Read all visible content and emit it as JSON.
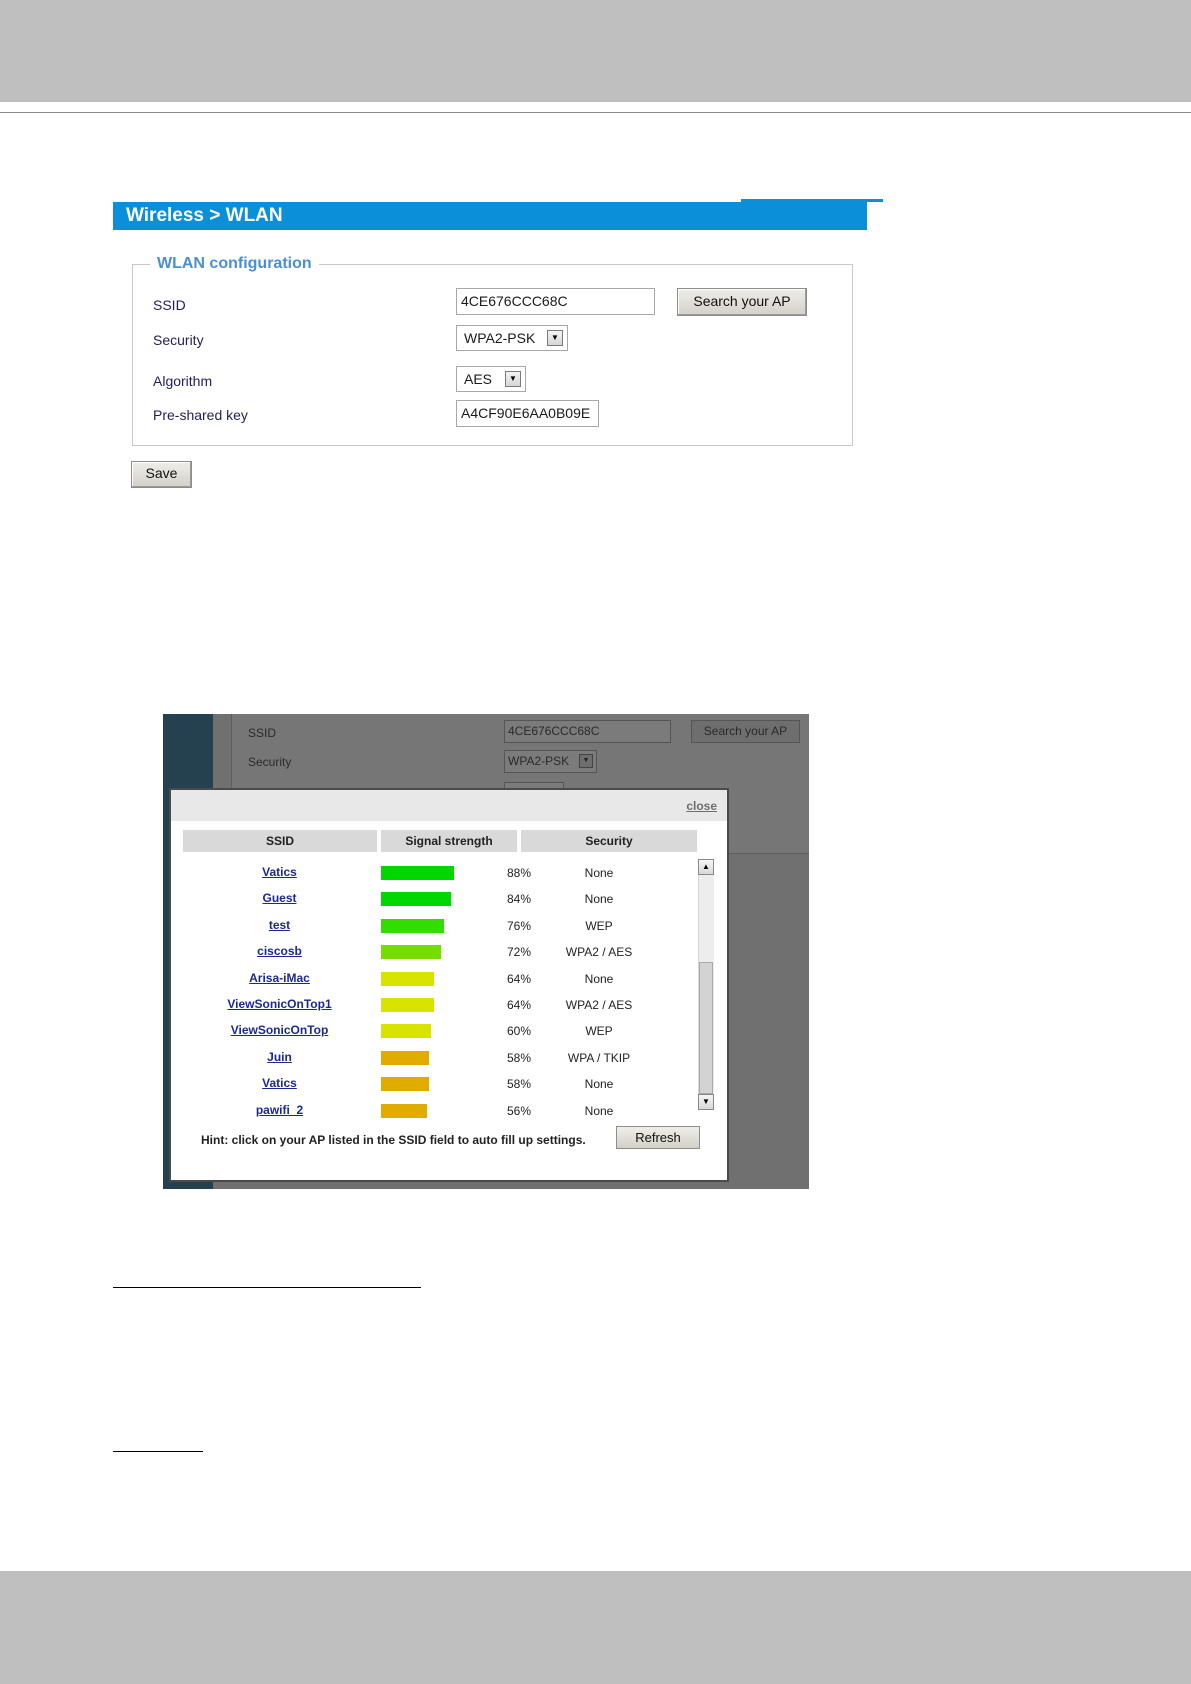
{
  "wlan_panel": {
    "breadcrumb": "Wireless  > WLAN",
    "legend": "WLAN configuration",
    "ssid_label": "SSID",
    "ssid_value": "4CE676CCC68C",
    "search_button": "Search your AP",
    "security_label": "Security",
    "security_value": "WPA2-PSK",
    "algorithm_label": "Algorithm",
    "algorithm_value": "AES",
    "psk_label": "Pre-shared key",
    "psk_value": "A4CF90E6AA0B09E",
    "save_button": "Save"
  },
  "background_form": {
    "ssid_label": "SSID",
    "ssid_value": "4CE676CCC68C",
    "search_button": "Search your AP",
    "security_label": "Security",
    "security_value": "WPA2-PSK"
  },
  "ap_dialog": {
    "close_link": "close",
    "headers": [
      "SSID",
      "Signal strength",
      "Security"
    ],
    "rows": [
      {
        "ssid": "Vatics",
        "signal": 88,
        "signal_label": "88%",
        "security": "None",
        "bar_color": "#00d600"
      },
      {
        "ssid": "Guest",
        "signal": 84,
        "signal_label": "84%",
        "security": "None",
        "bar_color": "#00d600"
      },
      {
        "ssid": "test",
        "signal": 76,
        "signal_label": "76%",
        "security": "WEP",
        "bar_color": "#33dd00"
      },
      {
        "ssid": "ciscosb",
        "signal": 72,
        "signal_label": "72%",
        "security": "WPA2 / AES",
        "bar_color": "#77dd00"
      },
      {
        "ssid": "Arisa-iMac",
        "signal": 64,
        "signal_label": "64%",
        "security": "None",
        "bar_color": "#d9e300"
      },
      {
        "ssid": "ViewSonicOnTop1",
        "signal": 64,
        "signal_label": "64%",
        "security": "WPA2 / AES",
        "bar_color": "#d9e300"
      },
      {
        "ssid": "ViewSonicOnTop",
        "signal": 60,
        "signal_label": "60%",
        "security": "WEP",
        "bar_color": "#d9e300"
      },
      {
        "ssid": "Juin",
        "signal": 58,
        "signal_label": "58%",
        "security": "WPA / TKIP",
        "bar_color": "#e0ac00"
      },
      {
        "ssid": "Vatics",
        "signal": 58,
        "signal_label": "58%",
        "security": "None",
        "bar_color": "#e0ac00"
      },
      {
        "ssid": "pawifi_2",
        "signal": 56,
        "signal_label": "56%",
        "security": "None",
        "bar_color": "#e0ac00"
      }
    ],
    "hint": "Hint: click on your AP listed in the SSID field to auto fill up settings.",
    "refresh_button": "Refresh"
  },
  "colors": {
    "header_band": "#0a8fd8",
    "legend_text": "#4a8fd0",
    "page_band": "#bfbfbf"
  }
}
